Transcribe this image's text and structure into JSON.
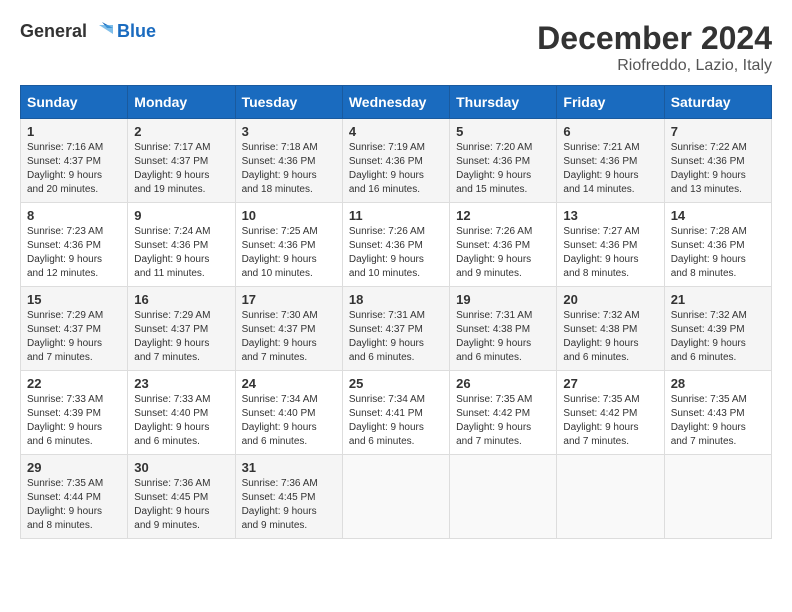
{
  "logo": {
    "text_general": "General",
    "text_blue": "Blue"
  },
  "header": {
    "month_title": "December 2024",
    "location": "Riofreddo, Lazio, Italy"
  },
  "weekdays": [
    "Sunday",
    "Monday",
    "Tuesday",
    "Wednesday",
    "Thursday",
    "Friday",
    "Saturday"
  ],
  "weeks": [
    [
      {
        "day": "1",
        "sunrise": "Sunrise: 7:16 AM",
        "sunset": "Sunset: 4:37 PM",
        "daylight": "Daylight: 9 hours and 20 minutes."
      },
      {
        "day": "2",
        "sunrise": "Sunrise: 7:17 AM",
        "sunset": "Sunset: 4:37 PM",
        "daylight": "Daylight: 9 hours and 19 minutes."
      },
      {
        "day": "3",
        "sunrise": "Sunrise: 7:18 AM",
        "sunset": "Sunset: 4:36 PM",
        "daylight": "Daylight: 9 hours and 18 minutes."
      },
      {
        "day": "4",
        "sunrise": "Sunrise: 7:19 AM",
        "sunset": "Sunset: 4:36 PM",
        "daylight": "Daylight: 9 hours and 16 minutes."
      },
      {
        "day": "5",
        "sunrise": "Sunrise: 7:20 AM",
        "sunset": "Sunset: 4:36 PM",
        "daylight": "Daylight: 9 hours and 15 minutes."
      },
      {
        "day": "6",
        "sunrise": "Sunrise: 7:21 AM",
        "sunset": "Sunset: 4:36 PM",
        "daylight": "Daylight: 9 hours and 14 minutes."
      },
      {
        "day": "7",
        "sunrise": "Sunrise: 7:22 AM",
        "sunset": "Sunset: 4:36 PM",
        "daylight": "Daylight: 9 hours and 13 minutes."
      }
    ],
    [
      {
        "day": "8",
        "sunrise": "Sunrise: 7:23 AM",
        "sunset": "Sunset: 4:36 PM",
        "daylight": "Daylight: 9 hours and 12 minutes."
      },
      {
        "day": "9",
        "sunrise": "Sunrise: 7:24 AM",
        "sunset": "Sunset: 4:36 PM",
        "daylight": "Daylight: 9 hours and 11 minutes."
      },
      {
        "day": "10",
        "sunrise": "Sunrise: 7:25 AM",
        "sunset": "Sunset: 4:36 PM",
        "daylight": "Daylight: 9 hours and 10 minutes."
      },
      {
        "day": "11",
        "sunrise": "Sunrise: 7:26 AM",
        "sunset": "Sunset: 4:36 PM",
        "daylight": "Daylight: 9 hours and 10 minutes."
      },
      {
        "day": "12",
        "sunrise": "Sunrise: 7:26 AM",
        "sunset": "Sunset: 4:36 PM",
        "daylight": "Daylight: 9 hours and 9 minutes."
      },
      {
        "day": "13",
        "sunrise": "Sunrise: 7:27 AM",
        "sunset": "Sunset: 4:36 PM",
        "daylight": "Daylight: 9 hours and 8 minutes."
      },
      {
        "day": "14",
        "sunrise": "Sunrise: 7:28 AM",
        "sunset": "Sunset: 4:36 PM",
        "daylight": "Daylight: 9 hours and 8 minutes."
      }
    ],
    [
      {
        "day": "15",
        "sunrise": "Sunrise: 7:29 AM",
        "sunset": "Sunset: 4:37 PM",
        "daylight": "Daylight: 9 hours and 7 minutes."
      },
      {
        "day": "16",
        "sunrise": "Sunrise: 7:29 AM",
        "sunset": "Sunset: 4:37 PM",
        "daylight": "Daylight: 9 hours and 7 minutes."
      },
      {
        "day": "17",
        "sunrise": "Sunrise: 7:30 AM",
        "sunset": "Sunset: 4:37 PM",
        "daylight": "Daylight: 9 hours and 7 minutes."
      },
      {
        "day": "18",
        "sunrise": "Sunrise: 7:31 AM",
        "sunset": "Sunset: 4:37 PM",
        "daylight": "Daylight: 9 hours and 6 minutes."
      },
      {
        "day": "19",
        "sunrise": "Sunrise: 7:31 AM",
        "sunset": "Sunset: 4:38 PM",
        "daylight": "Daylight: 9 hours and 6 minutes."
      },
      {
        "day": "20",
        "sunrise": "Sunrise: 7:32 AM",
        "sunset": "Sunset: 4:38 PM",
        "daylight": "Daylight: 9 hours and 6 minutes."
      },
      {
        "day": "21",
        "sunrise": "Sunrise: 7:32 AM",
        "sunset": "Sunset: 4:39 PM",
        "daylight": "Daylight: 9 hours and 6 minutes."
      }
    ],
    [
      {
        "day": "22",
        "sunrise": "Sunrise: 7:33 AM",
        "sunset": "Sunset: 4:39 PM",
        "daylight": "Daylight: 9 hours and 6 minutes."
      },
      {
        "day": "23",
        "sunrise": "Sunrise: 7:33 AM",
        "sunset": "Sunset: 4:40 PM",
        "daylight": "Daylight: 9 hours and 6 minutes."
      },
      {
        "day": "24",
        "sunrise": "Sunrise: 7:34 AM",
        "sunset": "Sunset: 4:40 PM",
        "daylight": "Daylight: 9 hours and 6 minutes."
      },
      {
        "day": "25",
        "sunrise": "Sunrise: 7:34 AM",
        "sunset": "Sunset: 4:41 PM",
        "daylight": "Daylight: 9 hours and 6 minutes."
      },
      {
        "day": "26",
        "sunrise": "Sunrise: 7:35 AM",
        "sunset": "Sunset: 4:42 PM",
        "daylight": "Daylight: 9 hours and 7 minutes."
      },
      {
        "day": "27",
        "sunrise": "Sunrise: 7:35 AM",
        "sunset": "Sunset: 4:42 PM",
        "daylight": "Daylight: 9 hours and 7 minutes."
      },
      {
        "day": "28",
        "sunrise": "Sunrise: 7:35 AM",
        "sunset": "Sunset: 4:43 PM",
        "daylight": "Daylight: 9 hours and 7 minutes."
      }
    ],
    [
      {
        "day": "29",
        "sunrise": "Sunrise: 7:35 AM",
        "sunset": "Sunset: 4:44 PM",
        "daylight": "Daylight: 9 hours and 8 minutes."
      },
      {
        "day": "30",
        "sunrise": "Sunrise: 7:36 AM",
        "sunset": "Sunset: 4:45 PM",
        "daylight": "Daylight: 9 hours and 9 minutes."
      },
      {
        "day": "31",
        "sunrise": "Sunrise: 7:36 AM",
        "sunset": "Sunset: 4:45 PM",
        "daylight": "Daylight: 9 hours and 9 minutes."
      },
      null,
      null,
      null,
      null
    ]
  ]
}
